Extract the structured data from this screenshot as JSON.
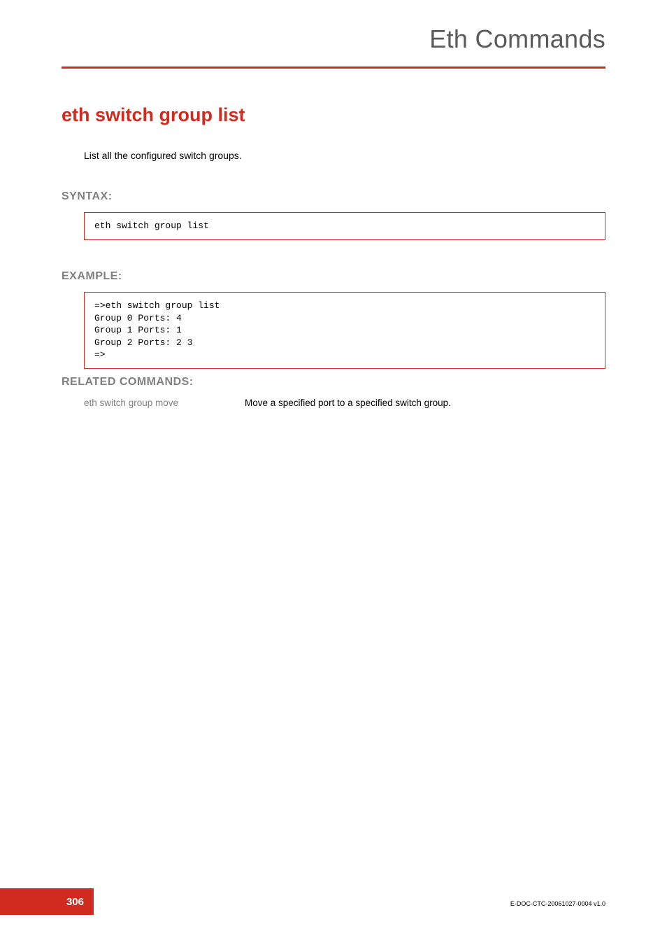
{
  "header": {
    "chapter_title": "Eth Commands"
  },
  "title": "eth switch group list",
  "intro": "List all the configured switch groups.",
  "sections": {
    "syntax_label": "SYNTAX:",
    "example_label": "EXAMPLE:",
    "related_label": "RELATED COMMANDS:"
  },
  "syntax_code": "eth switch group list",
  "example_code": "=>eth switch group list\nGroup 0 Ports: 4\nGroup 1 Ports: 1\nGroup 2 Ports: 2 3\n=>",
  "related": {
    "command": "eth switch group move",
    "description": "Move a specified port to a specified switch group."
  },
  "footer": {
    "page_number": "306",
    "doc_id": "E-DOC-CTC-20061027-0004 v1.0"
  }
}
